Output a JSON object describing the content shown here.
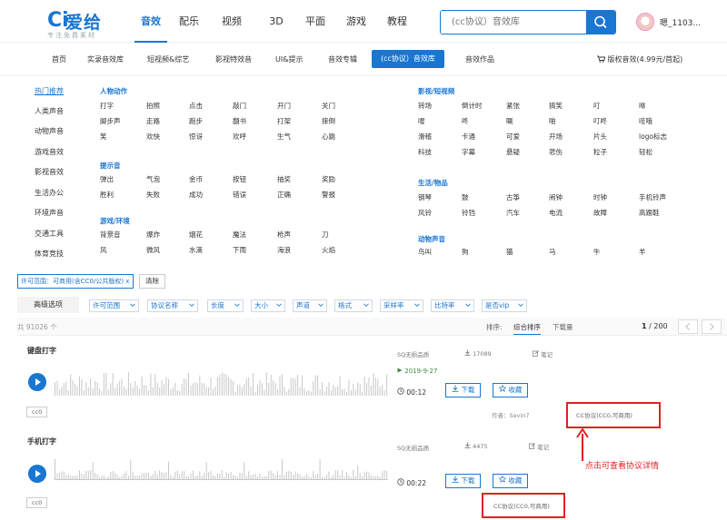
{
  "header": {
    "logo_mark": "Ci",
    "logo_name": "爱给",
    "slogan": "专注免费素材",
    "nav": [
      "音效",
      "配乐",
      "视频",
      "3D",
      "平面",
      "游戏",
      "教程"
    ],
    "active_nav": "音效",
    "search_placeholder": "(cc协议）音效库",
    "username": "嗯_1103..."
  },
  "subnav": {
    "items": [
      "首页",
      "实录音效库",
      "短视频&综艺",
      "影视特效音",
      "UI&提示",
      "音效专辑",
      "(cc协议）音效库",
      "音效作品"
    ],
    "active": "(cc协议）音效库",
    "vip": "版权音效(4.99元/首起)"
  },
  "categories": {
    "left": [
      "热门推荐",
      "人类声音",
      "动物声音",
      "游戏音效",
      "影视音效",
      "生活办公",
      "环境声音",
      "交通工具",
      "体育竞技"
    ],
    "groups": [
      {
        "title": "人物动作",
        "rows": [
          [
            "打字",
            "拍照",
            "点击",
            "敲门",
            "开门",
            "关门"
          ],
          [
            "脚步声",
            "走路",
            "跑步",
            "翻书",
            "打架",
            "摔倒"
          ],
          [
            "笑",
            "欢快",
            "惊讶",
            "欢呼",
            "生气",
            "心跳"
          ]
        ]
      },
      {
        "title": "提示音",
        "rows": [
          [
            "弹出",
            "气泡",
            "金币",
            "按钮",
            "抽奖",
            "奖励"
          ],
          [
            "胜利",
            "失败",
            "成功",
            "错误",
            "正确",
            "警报"
          ]
        ]
      },
      {
        "title": "游戏/环境",
        "rows": [
          [
            "背景音",
            "爆炸",
            "烟花",
            "魔法",
            "枪声",
            "刀"
          ],
          [
            "风",
            "微风",
            "水滴",
            "下雨",
            "海浪",
            "火焰"
          ]
        ]
      },
      {
        "title": "影视/短视频",
        "rows": [
          [
            "转场",
            "倒计时",
            "紧张",
            "搞笑",
            "叮",
            "咻"
          ],
          [
            "嗖",
            "咚",
            "唰",
            "啪",
            "叮咚",
            "哇哦"
          ],
          [
            "滑稽",
            "卡通",
            "可爱",
            "开场",
            "片头",
            "logo标志"
          ],
          [
            "科技",
            "字幕",
            "悬疑",
            "悲伤",
            "粒子",
            "轻松"
          ]
        ]
      },
      {
        "title": "生活/物品",
        "rows": [
          [
            "钢琴",
            "鼓",
            "古筝",
            "闹钟",
            "时钟",
            "手机铃声"
          ],
          [
            "风铃",
            "铃铛",
            "汽车",
            "电流",
            "故障",
            "高跟鞋"
          ]
        ]
      },
      {
        "title": "动物声音",
        "rows": [
          [
            "鸟叫",
            "狗",
            "猫",
            "马",
            "牛",
            "羊"
          ]
        ]
      }
    ]
  },
  "filter": {
    "tag": "许可范围：可商用(含CC0/公共版权)",
    "tag_close": "x",
    "clear": "清除"
  },
  "advanced": {
    "label": "高级选项",
    "options": [
      "许可范围",
      "协议名称",
      "长度",
      "大小",
      "声道",
      "格式",
      "采样率",
      "比特率",
      "是否vip"
    ]
  },
  "results": {
    "count": "共 91026 个",
    "sort_label": "排序:",
    "sort_options": [
      "综合排序",
      "下载量"
    ],
    "page_current": "1",
    "page_total": "/ 200"
  },
  "items": [
    {
      "title": "键盘打字",
      "quality": "SQ无损品质",
      "downloads": "17089",
      "note": "笔记",
      "date": "2019-9-27",
      "duration": "00:12",
      "download_btn": "下载",
      "fav_btn": "收藏",
      "license": "cc0",
      "author": "作者：Sevin7",
      "protocol": "CC协议(CC0,可商用)"
    },
    {
      "title": "手机打字",
      "quality": "SQ无损品质",
      "downloads": "4475",
      "note": "笔记",
      "duration": "00:22",
      "download_btn": "下载",
      "fav_btn": "收藏",
      "license": "cc0",
      "protocol": "CC协议(CC0,可商用)"
    }
  ],
  "annotation": "点击可查看协议详情",
  "colors": {
    "accent": "#1976d2",
    "annotation": "#e02020"
  }
}
